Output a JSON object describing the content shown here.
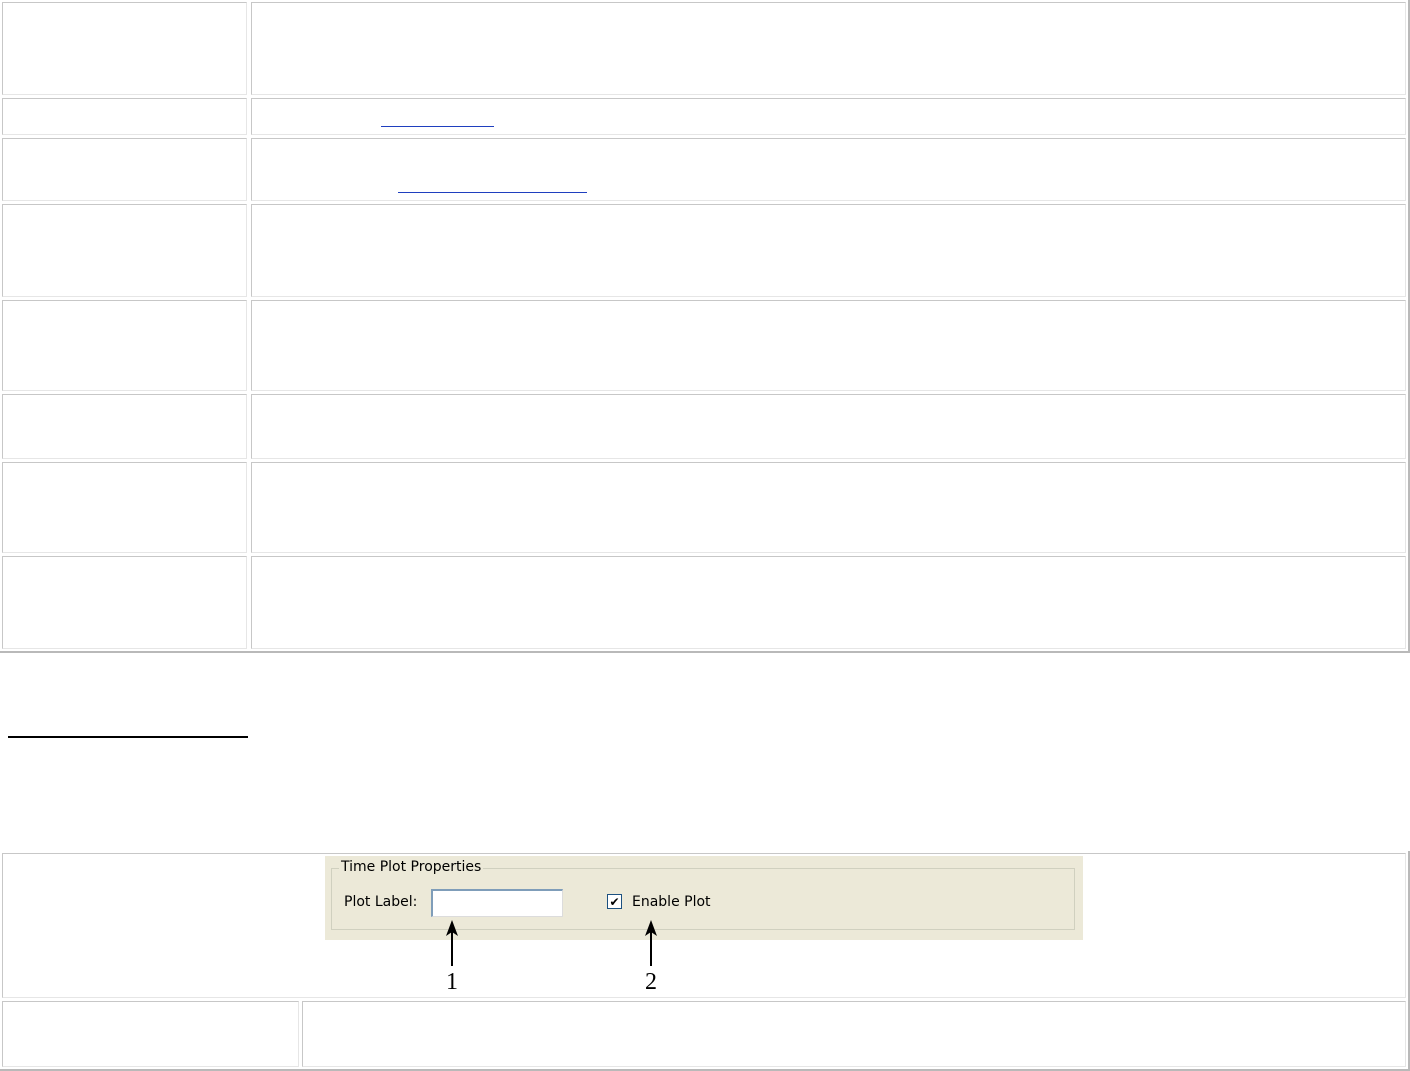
{
  "figure": {
    "group_title": "Time Plot Properties",
    "plot_label": {
      "label": "Plot Label:",
      "value": ""
    },
    "enable_plot": {
      "label": "Enable Plot",
      "checked": true,
      "check_glyph": "✔"
    },
    "callouts": [
      {
        "number": "1",
        "target": "plot-label-input"
      },
      {
        "number": "2",
        "target": "enable-plot-checkbox"
      }
    ]
  },
  "colors": {
    "dialog_background": "#ece9d8",
    "link": "#1f3fbf",
    "table_border": "#c7c7c7"
  }
}
